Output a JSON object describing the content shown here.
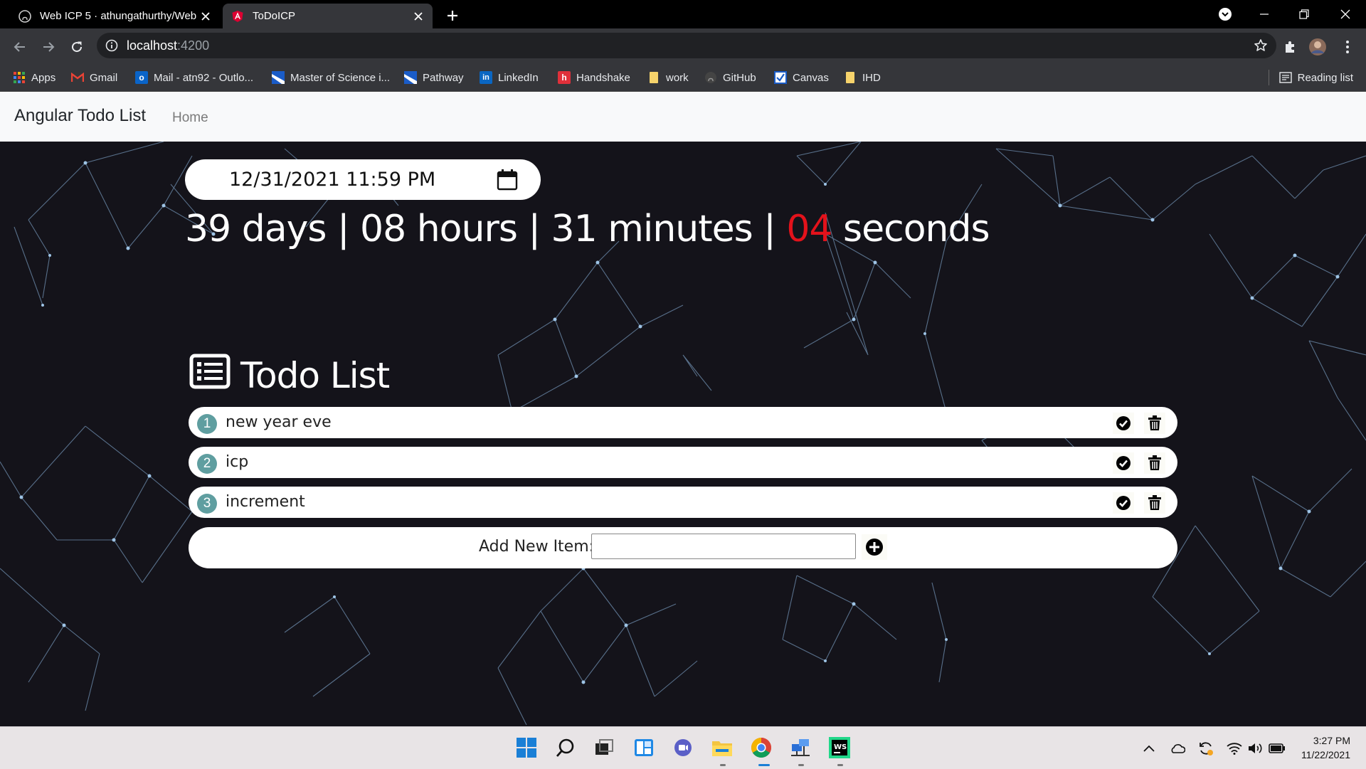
{
  "browser": {
    "tabs": [
      {
        "title": "Web ICP 5 · athungathurthy/Web",
        "favicon": "github-icon",
        "active": false
      },
      {
        "title": "ToDoICP",
        "favicon": "angular-icon",
        "active": true
      }
    ],
    "url_host": "localhost",
    "url_port": ":4200",
    "bookmarks": [
      {
        "label": "Apps",
        "icon": "apps-grid-icon"
      },
      {
        "label": "Gmail",
        "icon": "gmail-icon"
      },
      {
        "label": "Mail - atn92 - Outlo...",
        "icon": "outlook-icon"
      },
      {
        "label": "Master of Science i...",
        "icon": "umkc-icon"
      },
      {
        "label": "Pathway",
        "icon": "umkc-icon"
      },
      {
        "label": "LinkedIn",
        "icon": "linkedin-icon"
      },
      {
        "label": "Handshake",
        "icon": "handshake-icon"
      },
      {
        "label": "work",
        "icon": "folder-icon"
      },
      {
        "label": "GitHub",
        "icon": "github-icon"
      },
      {
        "label": "Canvas",
        "icon": "canvas-icon"
      },
      {
        "label": "IHD",
        "icon": "folder-icon"
      }
    ],
    "reading_list": "Reading list"
  },
  "navbar": {
    "brand": "Angular Todo List",
    "link": "Home"
  },
  "countdown": {
    "datetime_value": "12/31/2021 11:59 PM",
    "days": "39 days",
    "hours": "08 hours",
    "minutes": "31 minutes",
    "seconds_num": "04",
    "seconds_label": "seconds",
    "separator": "|",
    "seconds_color": "#e3121b"
  },
  "todo": {
    "heading": "Todo List",
    "items": [
      {
        "num": "1",
        "text": "new year eve"
      },
      {
        "num": "2",
        "text": "icp"
      },
      {
        "num": "3",
        "text": "increment"
      }
    ],
    "add_label": "Add New Item:",
    "add_value": ""
  },
  "taskbar": {
    "apps": [
      "windows-start-icon",
      "search-icon",
      "task-view-icon",
      "widgets-icon",
      "teams-chat-icon",
      "file-explorer-icon",
      "chrome-icon",
      "network-app-icon",
      "webstorm-icon"
    ],
    "time": "3:27 PM",
    "date": "11/22/2021"
  },
  "colors": {
    "accent_teal": "#5f9ea0",
    "page_bg": "#14131a",
    "chrome_dark": "#35363a"
  }
}
